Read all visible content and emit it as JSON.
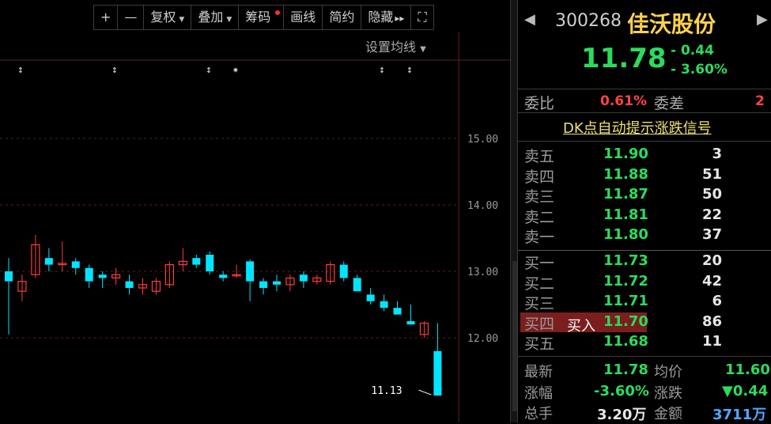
{
  "toolbar": {
    "plus": "+",
    "minus": "—",
    "fuquan": "复权",
    "diejia": "叠加",
    "chouma": "筹码",
    "huaxian": "画线",
    "jianyue": "简约",
    "yincang": "隐藏",
    "yincang_arrows": "▸▸",
    "fullscreen": "⛶"
  },
  "ma_setting": "设置均线",
  "chart_data": {
    "type": "candlestick",
    "y_ticks": [
      "15.00",
      "14.00",
      "13.00",
      "12.00"
    ],
    "ylim": [
      11.0,
      15.9
    ],
    "last_low_label": "11.13",
    "candles": [
      {
        "o": 13.0,
        "h": 13.2,
        "l": 12.05,
        "c": 12.85
      },
      {
        "o": 12.7,
        "h": 12.95,
        "l": 12.55,
        "c": 12.85
      },
      {
        "o": 12.95,
        "h": 13.55,
        "l": 12.9,
        "c": 13.4
      },
      {
        "o": 13.2,
        "h": 13.35,
        "l": 13.0,
        "c": 13.1
      },
      {
        "o": 13.1,
        "h": 13.45,
        "l": 13.0,
        "c": 13.12
      },
      {
        "o": 13.15,
        "h": 13.2,
        "l": 12.95,
        "c": 13.05
      },
      {
        "o": 13.05,
        "h": 13.1,
        "l": 12.75,
        "c": 12.85
      },
      {
        "o": 12.95,
        "h": 13.0,
        "l": 12.75,
        "c": 12.9
      },
      {
        "o": 12.9,
        "h": 13.05,
        "l": 12.8,
        "c": 12.95
      },
      {
        "o": 12.85,
        "h": 12.95,
        "l": 12.65,
        "c": 12.75
      },
      {
        "o": 12.75,
        "h": 12.9,
        "l": 12.65,
        "c": 12.8
      },
      {
        "o": 12.7,
        "h": 12.9,
        "l": 12.65,
        "c": 12.85
      },
      {
        "o": 12.8,
        "h": 13.15,
        "l": 12.75,
        "c": 13.1
      },
      {
        "o": 13.1,
        "h": 13.35,
        "l": 13.0,
        "c": 13.15
      },
      {
        "o": 13.2,
        "h": 13.25,
        "l": 13.05,
        "c": 13.1
      },
      {
        "o": 13.25,
        "h": 13.3,
        "l": 12.95,
        "c": 13.0
      },
      {
        "o": 12.95,
        "h": 13.0,
        "l": 12.85,
        "c": 12.9
      },
      {
        "o": 12.95,
        "h": 13.1,
        "l": 12.9,
        "c": 12.95
      },
      {
        "o": 13.15,
        "h": 13.18,
        "l": 12.55,
        "c": 12.85
      },
      {
        "o": 12.85,
        "h": 12.9,
        "l": 12.65,
        "c": 12.75
      },
      {
        "o": 12.85,
        "h": 12.95,
        "l": 12.7,
        "c": 12.8
      },
      {
        "o": 12.8,
        "h": 12.95,
        "l": 12.7,
        "c": 12.9
      },
      {
        "o": 12.95,
        "h": 13.0,
        "l": 12.75,
        "c": 12.85
      },
      {
        "o": 12.85,
        "h": 12.95,
        "l": 12.8,
        "c": 12.9
      },
      {
        "o": 12.85,
        "h": 13.15,
        "l": 12.8,
        "c": 13.1
      },
      {
        "o": 13.1,
        "h": 13.15,
        "l": 12.85,
        "c": 12.9
      },
      {
        "o": 12.9,
        "h": 12.95,
        "l": 12.7,
        "c": 12.7
      },
      {
        "o": 12.65,
        "h": 12.75,
        "l": 12.5,
        "c": 12.55
      },
      {
        "o": 12.55,
        "h": 12.65,
        "l": 12.4,
        "c": 12.45
      },
      {
        "o": 12.45,
        "h": 12.55,
        "l": 12.35,
        "c": 12.35
      },
      {
        "o": 12.25,
        "h": 12.5,
        "l": 12.2,
        "c": 12.2
      },
      {
        "o": 12.05,
        "h": 12.25,
        "l": 12.0,
        "c": 12.22
      },
      {
        "o": 11.8,
        "h": 12.22,
        "l": 11.13,
        "c": 11.13
      }
    ]
  },
  "quote": {
    "code": "300268",
    "name": "佳沃股份",
    "price": "11.78",
    "change": "- 0.44",
    "change_pct": "- 3.60%"
  },
  "weibi": {
    "label": "委比",
    "value": "0.61%",
    "diff_label": "委差",
    "diff_value": "2"
  },
  "dk_signal": "DK点自动提示涨跌信号",
  "sell": [
    {
      "label": "卖五",
      "price": "11.90",
      "vol": "3"
    },
    {
      "label": "卖四",
      "price": "11.88",
      "vol": "51"
    },
    {
      "label": "卖三",
      "price": "11.87",
      "vol": "50"
    },
    {
      "label": "卖二",
      "price": "11.81",
      "vol": "22"
    },
    {
      "label": "卖一",
      "price": "11.80",
      "vol": "37"
    }
  ],
  "buy": [
    {
      "label": "买一",
      "price": "11.73",
      "vol": "20"
    },
    {
      "label": "买二",
      "price": "11.72",
      "vol": "42"
    },
    {
      "label": "买三",
      "price": "11.71",
      "vol": "6"
    },
    {
      "label": "买四",
      "price": "11.70",
      "vol": "86"
    },
    {
      "label": "买五",
      "price": "11.68",
      "vol": "11"
    }
  ],
  "buy_badge": "买入",
  "stats": {
    "latest_label": "最新",
    "latest": "11.78",
    "avg_label": "均价",
    "avg": "11.60",
    "pct_label": "涨幅",
    "pct": "-3.60%",
    "chg_label": "涨跌",
    "chg": "▼0.44",
    "vol_label": "总手",
    "vol": "3.20万",
    "amt_label": "金额",
    "amt": "3711万"
  },
  "colors": {
    "up": "#ff3c3c",
    "down": "#00e5ff",
    "green": "#2bdc5c",
    "gold": "#ffd24a"
  }
}
